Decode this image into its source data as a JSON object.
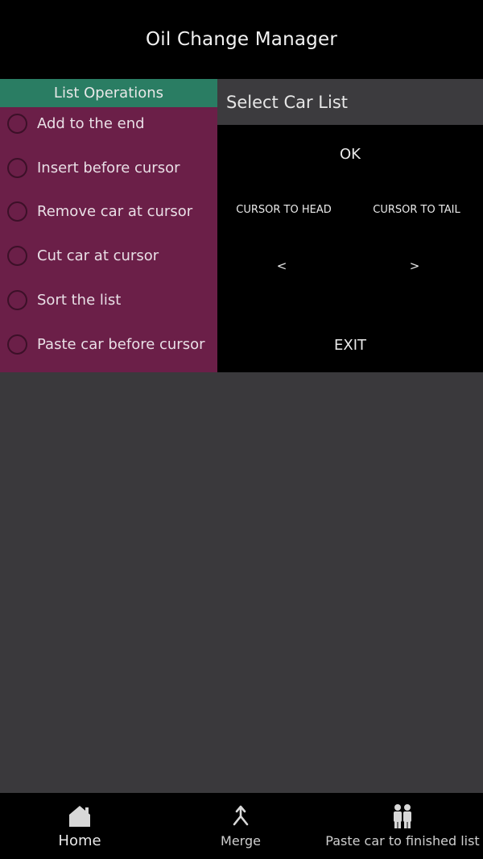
{
  "app": {
    "title": "Oil Change Manager"
  },
  "operations": {
    "header": "List Operations",
    "items": [
      {
        "label": "Add to the end"
      },
      {
        "label": "Insert before cursor"
      },
      {
        "label": "Remove car at cursor"
      },
      {
        "label": "Cut car at cursor"
      },
      {
        "label": "Sort the list"
      },
      {
        "label": "Paste car before cursor"
      }
    ]
  },
  "car_list": {
    "header": "Select Car List",
    "ok": "OK",
    "cursor_to_head": "CURSOR TO HEAD",
    "cursor_to_tail": "CURSOR TO TAIL",
    "prev": "<",
    "next": ">",
    "exit": "EXIT"
  },
  "bottom_nav": {
    "home": {
      "label": "Home",
      "icon": "home-icon"
    },
    "merge": {
      "label": "Merge",
      "icon": "merge-icon"
    },
    "paste": {
      "label": "Paste car to finished list",
      "icon": "people-icon"
    }
  },
  "colors": {
    "ops_panel": "#6b1f48",
    "ops_header": "#2a7d63",
    "background": "#3a393c"
  }
}
